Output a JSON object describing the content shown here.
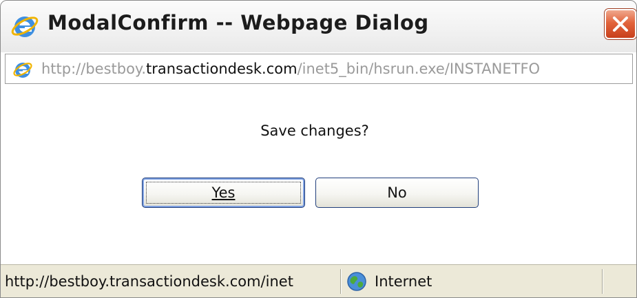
{
  "window": {
    "title": "ModalConfirm -- Webpage Dialog"
  },
  "address": {
    "scheme_prefix": "http://bestboy.",
    "host": "transactiondesk.com",
    "path": "/inet5_bin/hsrun.exe/INSTANETFO"
  },
  "dialog": {
    "prompt": "Save changes?",
    "yes_label": "Yes",
    "no_label": "No"
  },
  "statusbar": {
    "url": "http://bestboy.transactiondesk.com/inet",
    "zone": "Internet"
  },
  "icons": {
    "title": "ie-icon",
    "close": "close-icon",
    "address": "ie-icon",
    "zone": "globe-icon"
  },
  "colors": {
    "close_button": "#e2643c",
    "button_border": "#1f3d7a",
    "statusbar_bg": "#ece9d8"
  }
}
